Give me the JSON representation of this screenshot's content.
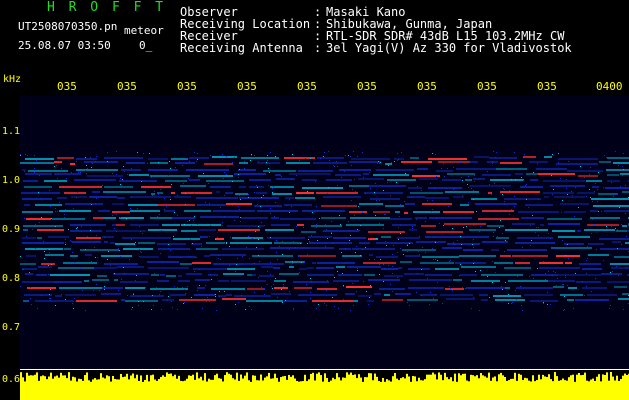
{
  "header": {
    "logo_text": "H R O F F T",
    "file_name": "UT2508070350.pn",
    "file_tag": "meteor",
    "date_time": "25.08.07 03:50",
    "counter": "0_"
  },
  "station_info": [
    {
      "label": "Observer",
      "value": "Masaki Kano"
    },
    {
      "label": "Receiving Location",
      "value": "Shibukawa, Gunma, Japan"
    },
    {
      "label": "Receiver",
      "value": "RTL-SDR SDR# 43dB L15 103.2MHz CW"
    },
    {
      "label": "Receiving Antenna",
      "value": "3el Yagi(V) Az 330 for Vladivostok"
    }
  ],
  "colon": ":",
  "y_axis": {
    "unit": "kHz",
    "ticks": [
      "1.1",
      "1.0",
      "0.9",
      "0.8",
      "0.7",
      "0.6"
    ],
    "range": [
      0.6,
      1.15
    ]
  },
  "x_axis": {
    "ticks": [
      "035",
      "035",
      "035",
      "035",
      "035",
      "035",
      "035",
      "035",
      "035",
      "0400"
    ]
  },
  "colors": {
    "background": "#000000",
    "axis_labels": "#ffff00",
    "logo": "#22dd22",
    "text": "#ffffff",
    "level_meter": "#ffff00",
    "trace_low": "#1030d0",
    "trace_mid": "#00c8e8",
    "trace_high": "#ff3030"
  }
}
